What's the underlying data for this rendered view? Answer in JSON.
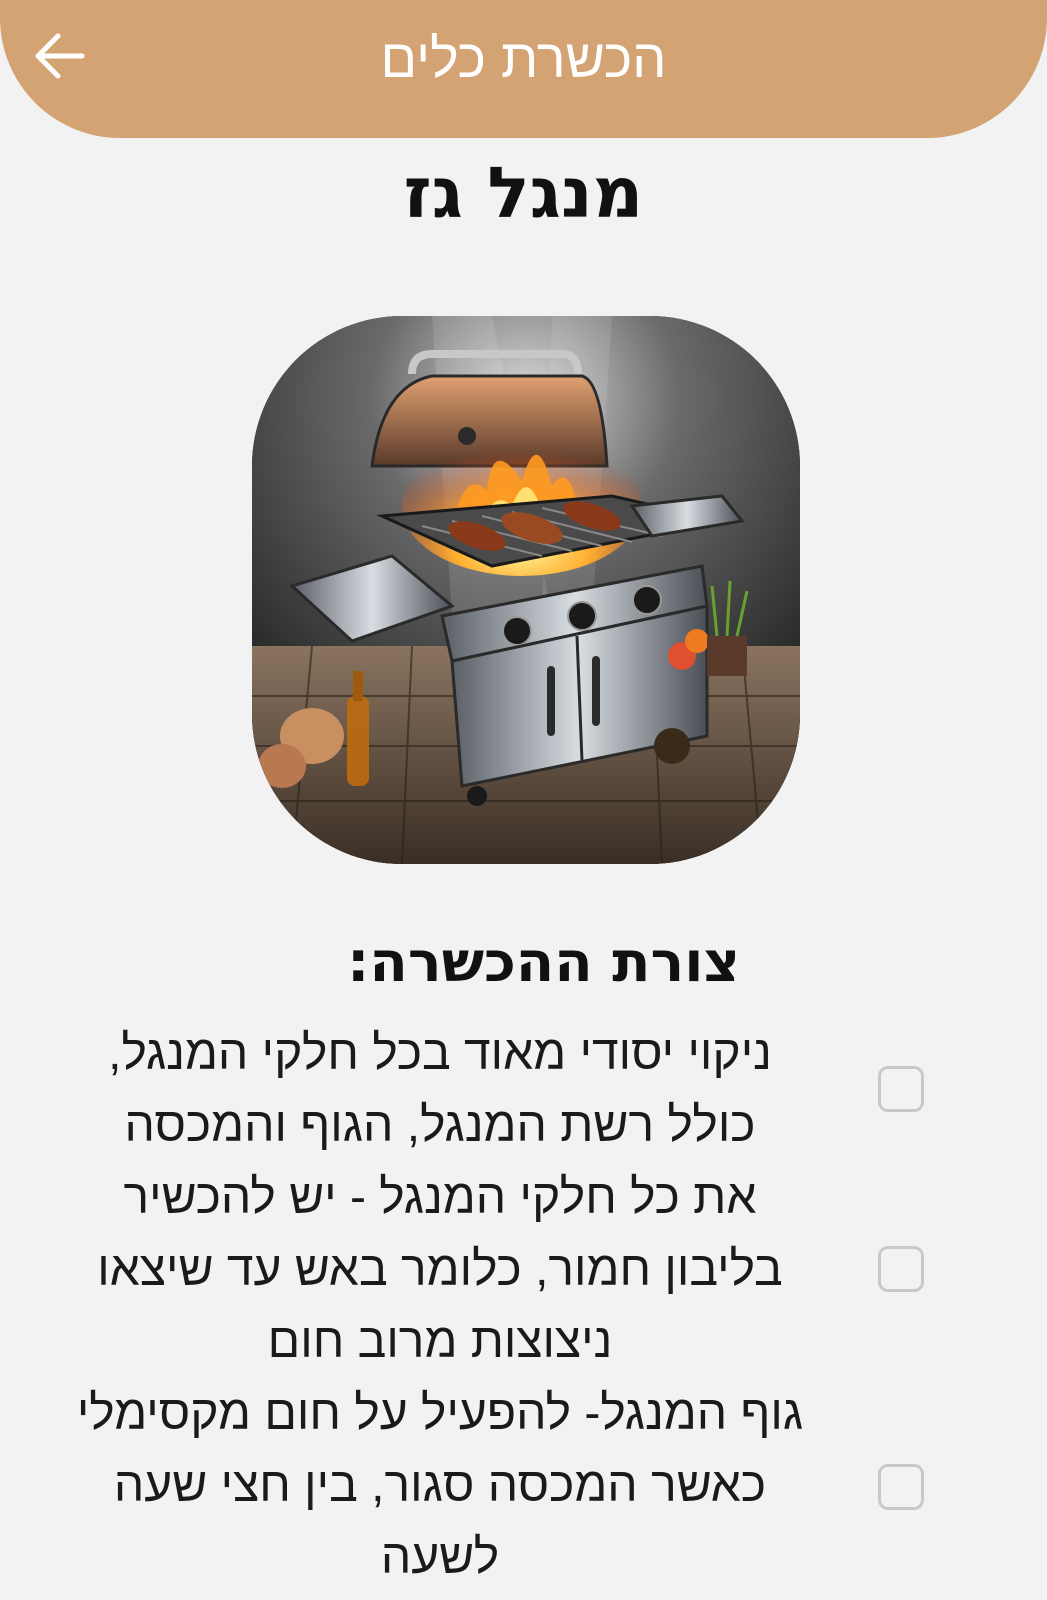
{
  "header": {
    "title": "הכשרת כלים",
    "back_icon": "arrow-left-icon",
    "color": "#d4a373"
  },
  "page": {
    "title": "מנגל גז",
    "image": "gas-grill-image"
  },
  "section": {
    "title": "צורת ההכשרה:"
  },
  "steps": [
    {
      "text": "ניקוי יסודי מאוד בכל חלקי המנגל, כולל רשת המנגל, הגוף והמכסה",
      "checked": false
    },
    {
      "text": "את כל חלקי המנגל - יש להכשיר בליבון חמור, כלומר באש עד שיצאו ניצוצות מרוב חום",
      "checked": false
    },
    {
      "text": "גוף המנגל- להפעיל על חום מקסימלי כאשר המכסה סגור, בין חצי שעה לשעה",
      "checked": false
    }
  ]
}
